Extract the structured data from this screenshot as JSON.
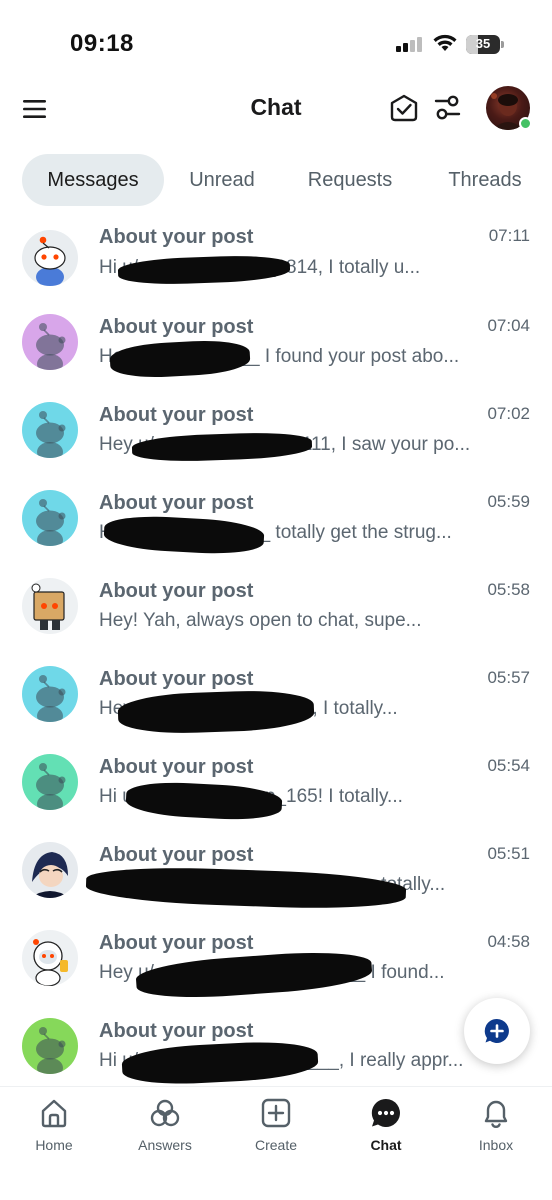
{
  "status_bar": {
    "time": "09:18",
    "battery_level": "35"
  },
  "header": {
    "title": "Chat"
  },
  "tabs": [
    {
      "label": "Messages",
      "active": true
    },
    {
      "label": "Unread",
      "active": false
    },
    {
      "label": "Requests",
      "active": false
    },
    {
      "label": "Threads",
      "active": false
    }
  ],
  "messages": [
    {
      "title": "About your post",
      "time": "07:11",
      "preview": "Hi u/_____________3814, I totally u...",
      "avatar": "snoo-white-blue",
      "avatar_color": "#e9edf0"
    },
    {
      "title": "About your post",
      "time": "07:04",
      "preview": "Hey u/__________ I found your post abo...",
      "avatar": "snoo-default-purple",
      "avatar_color": "#d8a6ea"
    },
    {
      "title": "About your post",
      "time": "07:02",
      "preview": "Hey u/_____________5111, I saw your po...",
      "avatar": "snoo-default-teal",
      "avatar_color": "#6fd8e8"
    },
    {
      "title": "About your post",
      "time": "05:59",
      "preview": "Hey u/___________ totally get the strug...",
      "avatar": "snoo-default-teal",
      "avatar_color": "#6fd8e8"
    },
    {
      "title": "About your post",
      "time": "05:58",
      "preview": "Hey! Yah, always open to chat, supe...",
      "avatar": "snoo-box-costume",
      "avatar_color": "#eef1f3"
    },
    {
      "title": "About your post",
      "time": "05:57",
      "preview": "Hey u/___________4243, I totally...",
      "avatar": "snoo-default-teal",
      "avatar_color": "#6fd8e8"
    },
    {
      "title": "About your post",
      "time": "05:54",
      "preview": "Hi u/___________up_165! I totally...",
      "avatar": "snoo-default-green",
      "avatar_color": "#63e0b4"
    },
    {
      "title": "About your post",
      "time": "05:51",
      "preview": "Hi u/_______________________totally...",
      "avatar": "snoo-dark-hair",
      "avatar_color": "#e6eaee"
    },
    {
      "title": "About your post",
      "time": "04:58",
      "preview": "Hey u/____________________ I found...",
      "avatar": "snoo-astronaut",
      "avatar_color": "#eef1f3"
    },
    {
      "title": "About your post",
      "time": "",
      "preview": "Hi u/___________________, I really appr...",
      "avatar": "snoo-default-lime",
      "avatar_color": "#86d85a"
    }
  ],
  "bottom_nav": [
    {
      "label": "Home",
      "icon": "home-icon",
      "active": false
    },
    {
      "label": "Answers",
      "icon": "answers-icon",
      "active": false
    },
    {
      "label": "Create",
      "icon": "create-icon",
      "active": false
    },
    {
      "label": "Chat",
      "icon": "chat-icon",
      "active": true
    },
    {
      "label": "Inbox",
      "icon": "bell-icon",
      "active": false
    }
  ],
  "fab": {
    "icon": "new-chat-icon",
    "color": "#0e3a8c"
  }
}
